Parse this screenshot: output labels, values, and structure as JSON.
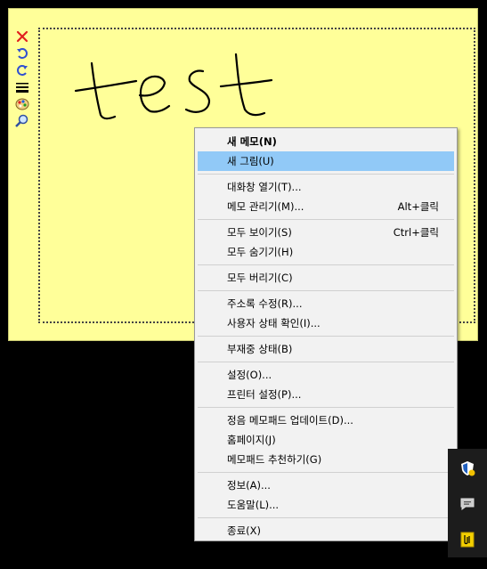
{
  "memo": {
    "background": "#ffff99",
    "tools": [
      {
        "name": "close-icon"
      },
      {
        "name": "undo-icon"
      },
      {
        "name": "redo-icon"
      },
      {
        "name": "line-width-icon"
      },
      {
        "name": "color-palette-icon"
      },
      {
        "name": "zoom-icon"
      }
    ],
    "drawing_text": "test"
  },
  "menu": {
    "items": [
      {
        "label": "새 메모(N)",
        "bold": true
      },
      {
        "label": "새 그림(U)",
        "highlighted": true
      },
      {
        "label": "대화창 열기(T)..."
      },
      {
        "label": "메모 관리기(M)...",
        "shortcut": "Alt+클릭"
      },
      {
        "label": "모두 보이기(S)",
        "shortcut": "Ctrl+클릭"
      },
      {
        "label": "모두 숨기기(H)"
      },
      {
        "label": "모두 버리기(C)"
      },
      {
        "label": "주소록 수정(R)..."
      },
      {
        "label": "사용자 상태 확인(I)..."
      },
      {
        "label": "부재중 상태(B)"
      },
      {
        "label": "설정(O)..."
      },
      {
        "label": "프린터 설정(P)..."
      },
      {
        "label": "정음 메모패드 업데이트(D)..."
      },
      {
        "label": "홈페이지(J)"
      },
      {
        "label": "메모패드 추천하기(G)"
      },
      {
        "label": "정보(A)..."
      },
      {
        "label": "도움말(L)..."
      },
      {
        "label": "종료(X)"
      }
    ],
    "highlight_color": "#91c9f7"
  },
  "tray": {
    "icons": [
      {
        "name": "security-shield-icon"
      },
      {
        "name": "chat-bubble-icon"
      },
      {
        "name": "memopad-tray-icon"
      }
    ]
  }
}
